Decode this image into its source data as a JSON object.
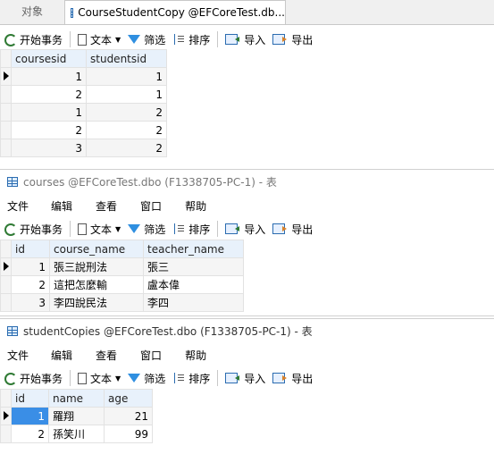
{
  "top_tabs": {
    "objects": "对象",
    "active_tab": "CourseStudentCopy @EFCoreTest.db..."
  },
  "toolbar": {
    "begin_txn": "开始事务",
    "text": "文本",
    "filter": "筛选",
    "sort": "排序",
    "import": "导入",
    "export": "导出"
  },
  "menu": {
    "file": "文件",
    "edit": "编辑",
    "view": "查看",
    "window": "窗口",
    "help": "帮助"
  },
  "pane1": {
    "columns": [
      "coursesid",
      "studentsid"
    ],
    "rows": [
      [
        "1",
        "1"
      ],
      [
        "2",
        "1"
      ],
      [
        "1",
        "2"
      ],
      [
        "2",
        "2"
      ],
      [
        "3",
        "2"
      ]
    ]
  },
  "pane2": {
    "title": "courses @EFCoreTest.dbo (F1338705-PC-1) - 表",
    "columns": [
      "id",
      "course_name",
      "teacher_name"
    ],
    "rows": [
      [
        "1",
        "張三說刑法",
        "張三"
      ],
      [
        "2",
        "這把怎麼輸",
        "盧本偉"
      ],
      [
        "3",
        "李四說民法",
        "李四"
      ]
    ]
  },
  "pane3": {
    "title": "studentCopies @EFCoreTest.dbo (F1338705-PC-1) - 表",
    "columns": [
      "id",
      "name",
      "age"
    ],
    "rows": [
      [
        "1",
        "羅翔",
        "21"
      ],
      [
        "2",
        "孫笑川",
        "99"
      ]
    ]
  }
}
